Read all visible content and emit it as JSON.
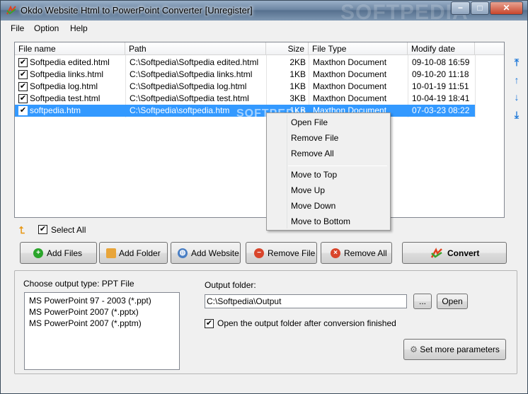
{
  "window": {
    "title": "Okdo Website Html to PowerPoint Converter [Unregister]",
    "watermark": "SOFTPEDIA",
    "controls": {
      "minimize": "−",
      "maximize": "□",
      "close": "✕"
    }
  },
  "menu": {
    "items": [
      "File",
      "Option",
      "Help"
    ]
  },
  "file_list": {
    "columns": [
      "File name",
      "Path",
      "Size",
      "File Type",
      "Modify date"
    ],
    "rows": [
      {
        "checked": true,
        "name": "Softpedia edited.html",
        "path": "C:\\Softpedia\\Softpedia edited.html",
        "size": "2KB",
        "type": "Maxthon Document",
        "date": "09-10-08 16:59",
        "selected": false
      },
      {
        "checked": true,
        "name": "Softpedia links.html",
        "path": "C:\\Softpedia\\Softpedia links.html",
        "size": "1KB",
        "type": "Maxthon Document",
        "date": "09-10-20 11:18",
        "selected": false
      },
      {
        "checked": true,
        "name": "Softpedia log.html",
        "path": "C:\\Softpedia\\Softpedia log.html",
        "size": "1KB",
        "type": "Maxthon Document",
        "date": "10-01-19 11:51",
        "selected": false
      },
      {
        "checked": true,
        "name": "Softpedia test.html",
        "path": "C:\\Softpedia\\Softpedia test.html",
        "size": "3KB",
        "type": "Maxthon Document",
        "date": "10-04-19 18:41",
        "selected": false
      },
      {
        "checked": true,
        "name": "softpedia.htm",
        "path": "C:\\Softpedia\\softpedia.htm",
        "size": "1KB",
        "type": "Maxthon Document",
        "date": "07-03-23 08:22",
        "selected": true
      }
    ],
    "watermark": "SOFTPEDIA"
  },
  "side_buttons": [
    "move-top-icon",
    "move-up-icon",
    "move-down-icon",
    "move-bottom-icon"
  ],
  "context_menu": {
    "items": [
      "Open File",
      "Remove File",
      "Remove All",
      "Move to Top",
      "Move Up",
      "Move Down",
      "Move to Bottom"
    ]
  },
  "select_all": {
    "label": "Select All",
    "checked": true
  },
  "buttons": {
    "add_files": "Add Files",
    "add_folder": "Add Folder",
    "add_website": "Add Website",
    "remove_file": "Remove File",
    "remove_all": "Remove All",
    "convert": "Convert"
  },
  "output": {
    "type_label": "Choose output type:  PPT File",
    "types": [
      "MS PowerPoint 97 - 2003 (*.ppt)",
      "MS PowerPoint 2007 (*.pptx)",
      "MS PowerPoint 2007 (*.pptm)"
    ],
    "folder_label": "Output folder:",
    "folder_value": "C:\\Softpedia\\Output",
    "browse": "...",
    "open": "Open",
    "open_after_label": "Open the output folder after conversion finished",
    "open_after_checked": true,
    "more_params": "Set more parameters"
  },
  "colors": {
    "selection": "#3399ff",
    "accent_blue": "#1e78d8",
    "add": "#2aa52a",
    "remove": "#d9452b",
    "folder": "#e8a53a"
  }
}
